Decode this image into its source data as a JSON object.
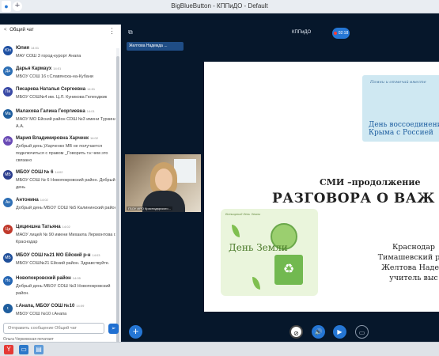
{
  "browser": {
    "window_title": "BigBlueButton - КППиДО - Default",
    "new_tab": "+"
  },
  "chat": {
    "back_symbol": "<",
    "title": "Общий чат",
    "menu_symbol": "⋮",
    "messages": [
      {
        "initials": "Юл",
        "name": "Юлия",
        "time": "14:01",
        "text": "МАУ СОШ 3 город-курорт Анапа"
      },
      {
        "initials": "Да",
        "name": "Дарья Кармаух",
        "time": "14:01",
        "text": "МБОУ СОШ 16 г.Славянска-на-Кубани"
      },
      {
        "initials": "Пи",
        "name": "Писарева Наталья Сергеевна",
        "time": "14:01",
        "text": "МБОУ СОШ№4 им. Ц.Л. Куникова Геленджик"
      },
      {
        "initials": "Ма",
        "name": "Малахова Галина Георгиевна",
        "time": "14:01",
        "text": "МАОУ МО Ейский район СОШ №3 имени Туркина А.А."
      },
      {
        "initials": "Ма",
        "name": "Мария Владимировна Харченк",
        "time": "14:02",
        "text": "Добрый день )Харченко МВ не получается подключиться с правом _Говорить т.к чем это связано"
      },
      {
        "initials": "МБ",
        "name": "МБОУ СОШ № 6",
        "time": "14:02",
        "text": "МБОУ СОШ № 6 Новопокровский район. Добрый день"
      },
      {
        "initials": "Ан",
        "name": "Антонина",
        "time": "14:02",
        "text": "Добрый день МБОУ СОШ №5 Калининский район"
      },
      {
        "initials": "Ци",
        "name": "Цициншна Татьяна",
        "time": "14:02",
        "text": "МАОУ лицей № 90 имени Михаила Лермонтова г. Краснодар"
      },
      {
        "initials": "МБ",
        "name": "МБОУ СОШ №21 МО Ейский р-н",
        "time": "14:03",
        "text": "МБОУ СОШ№21 Ейский район. Здравствуйте."
      },
      {
        "initials": "Но",
        "name": "Новопокровский район",
        "time": "14:05",
        "text": "Добрый день МБОУ СОШ №3 Новопокровский район."
      },
      {
        "initials": "г.",
        "name": "г.Анапа, МБОУ СОШ №10",
        "time": "14:09",
        "text": "МБОУ СОШ №10 г.Анапа"
      }
    ],
    "compose_placeholder": "Отправить сообщение Общий чат",
    "send_symbol": "➢",
    "typing": "Ольга Черкевская печатает"
  },
  "meeting": {
    "room_name": "КППиДО",
    "recording_time": "02:18",
    "presenter_chip": "Желтова Надежда ...",
    "webcam_label": "ГБОУ ИРО Краснодарского..."
  },
  "slide": {
    "crimea_card": {
      "cursive": "Помни и отмечай вместе",
      "title": "День воссоединения Крыма с Россией"
    },
    "title_line1": "СМИ –продолжение",
    "title_line2": "РАЗГОВОРА О ВАЖ",
    "earth_card": {
      "tagline": "Всемирный день Земли",
      "title": "День Земли",
      "bag_symbol": "♻"
    },
    "info_lines": [
      "Краснодар",
      "Тимашевский рай",
      "Желтова Надеж",
      "учитель выс"
    ]
  },
  "controls": {
    "plus_symbol": "+",
    "present_symbol": "⊘",
    "audio_symbol": "🔊",
    "video_symbol": "▶",
    "share_symbol": "▭"
  },
  "colors": {
    "background": "#06172b",
    "accent_blue": "#2576d4",
    "chat_bg": "#ffffff"
  },
  "avatar_colors": [
    "#1e50a2",
    "#2d6fb5",
    "#3a4aa6",
    "#1f5e9e",
    "#6a4bb5",
    "#2c3e8e",
    "#2f6fb5",
    "#c0392b",
    "#1f4f9a",
    "#2566b3",
    "#1f5e9e"
  ],
  "icons": [
    "users-icon",
    "record-dot-icon",
    "send-icon",
    "plus-icon",
    "no-presentation-icon",
    "audio-icon",
    "video-icon",
    "screen-share-icon",
    "kebab-menu-icon",
    "back-chevron-icon"
  ]
}
